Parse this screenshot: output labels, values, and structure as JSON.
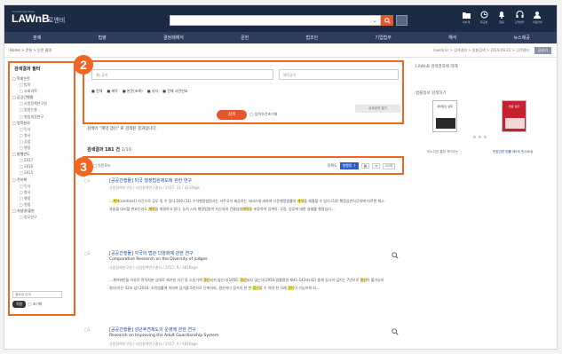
{
  "app": {
    "logo": "LAWnB",
    "logo_tiny": "Knowledge Base",
    "logo_sub": "로앤비"
  },
  "toolbar": {
    "icons": [
      {
        "name": "folder-icon",
        "label": "내서재"
      },
      {
        "name": "history-icon",
        "label": "최근본"
      },
      {
        "name": "bell-icon",
        "label": "알림"
      },
      {
        "name": "headset-icon",
        "label": "고객센터"
      },
      {
        "name": "user-icon",
        "label": "사용안내"
      }
    ]
  },
  "nav": {
    "items": [
      "판례",
      "법령",
      "결정례해석",
      "문헌",
      "법조인",
      "기업법무",
      "해석",
      "뉴스제공"
    ]
  },
  "breadcrumb": {
    "left": "Home > 문헌 > 논문 결과",
    "right_path": "lawnb.kr > 검색결과 > 맞춤검색 > 2019.09.22 > 고객센터",
    "button": "공유기"
  },
  "sidebar": {
    "title": "검색결과 필터",
    "items": [
      {
        "label": "□ 학회논문",
        "sub": false
      },
      {
        "label": "□ 법학",
        "sub": true
      },
      {
        "label": "□ 사회과학",
        "sub": true
      },
      {
        "label": "□ 공공간행물",
        "sub": false
      },
      {
        "label": "□ 사법정책연구원",
        "sub": true
      },
      {
        "label": "□ 법원논총",
        "sub": true
      },
      {
        "label": "□ 형법개정연구",
        "sub": true
      },
      {
        "label": "□ 법학분야",
        "sub": false
      },
      {
        "label": "□ 민사",
        "sub": true
      },
      {
        "label": "□ 형사",
        "sub": true
      },
      {
        "label": "□ 공법",
        "sub": true
      },
      {
        "label": "□ 행정",
        "sub": true
      },
      {
        "label": "□ 발행연도",
        "sub": false
      },
      {
        "label": "□ 2017",
        "sub": true
      },
      {
        "label": "□ 2016",
        "sub": true
      },
      {
        "label": "□ 2015",
        "sub": true
      },
      {
        "label": "□ 전자책",
        "sub": false
      },
      {
        "label": "□ 민사",
        "sub": true
      },
      {
        "label": "□ 형사",
        "sub": true
      },
      {
        "label": "□ 행정",
        "sub": true
      },
      {
        "label": "□ 헌법",
        "sub": true
      },
      {
        "label": "□ 저널명/출판",
        "sub": false
      },
      {
        "label": "□ 법무연구",
        "sub": true
      }
    ],
    "search_placeholder": "결과내 검색",
    "apply": "적용",
    "reset": "◯ 초기화"
  },
  "search": {
    "field1": "예) 검색",
    "field2": "제목검색",
    "checks": [
      "■ 전체",
      "■ 제목",
      "■ 본문(초록)",
      "■ 저자",
      "■ 전체 사전번호"
    ],
    "go": "검색",
    "reset_all": "◯ 입력조건초기화",
    "advanced": "상세검색 열기"
  },
  "summary": "검색어 \"계약 갱신\" 로 검색된 결과입니다.",
  "count": {
    "label": "검색결과 181 건",
    "pages": "1/10"
  },
  "result_bar": {
    "left": "□ 다운로드",
    "sort_label": "정확도",
    "sort_pill": "발행일 ↑",
    "per_page": "20개"
  },
  "results": [
    {
      "num": "□1",
      "title": "[공공간행물] 미국 행정법원제도에 관한 연구",
      "meta": "사법정책연구원 / 사법정책연구총서 / 2017. 11 / 311Page",
      "body": [
        {
          "t": "..."
        },
        {
          "t": "계약",
          "m": true
        },
        {
          "t": "(contract) 사건으로 공무 및 수 있다.100.(11) 수석행정법원사는 서주국이 제공하는 서비스에 대하여 다운"
        },
        {
          "t": "행정법률의 "
        },
        {
          "t": "계약",
          "m": true
        },
        {
          "t": "을 채결할 수 있다.(14) 행정심판사무처에 따르면 재소자들을 대리할 변호인과도 "
        },
        {
          "t": "계약",
          "m": true
        },
        {
          "t": "을 체결하"
        },
        {
          "t": "고 있다. 능차 시의 행정법원의 자산과의 건물임대"
        },
        {
          "t": "계약",
          "m": true
        },
        {
          "t": "을 포함하여 업계의, 규정, 업무에 대한 실제를 행정심리..."
        }
      ]
    },
    {
      "num": "□2",
      "title": "[공공간행물] 각국의 법관 다양화에 관한 연구",
      "sub": "Comparative Research on the Diversity of Judges",
      "meta": "사법정책연구원 / 사법정책연구총서 / 2017. 9 / 381Page",
      "body": [
        {
          "t": "...계약",
          "m": false
        },
        {
          "t": "위반을 이유로 면직처분 상대로 제기한 사건 중 소송가액 "
        },
        {
          "t": "갱신",
          "m": true
        },
        {
          "t": "되지 않는다(1956. "
        },
        {
          "t": "갱신",
          "m": true
        },
        {
          "t": "되지 않는다(1956."
        },
        {
          "t": "법률명칭 제41-143조)42) 중재 임시의 임기는 7년으로 "
        },
        {
          "t": "갱신",
          "m": true
        },
        {
          "t": "이 불가능하였다(이은 42조 상) 2016. 조직"
        },
        {
          "t": "법률에 의하여 임기를 5년으로 단축하되, 갱신하다 장기의 한 번 "
        },
        {
          "t": "갱신",
          "m": true
        },
        {
          "t": "할 수 하여 한 차례 "
        },
        {
          "t": "갱신",
          "m": true
        },
        {
          "t": "이 가능하게 되..."
        }
      ]
    },
    {
      "num": "□3",
      "title": "[공공간행물] 성년후견제도의 운영에 관한 연구",
      "sub": "Research on Improving the Adult Guardianship System",
      "meta": "사법정책연구원 / 사법정책연구총서 / 2017. 9 / 481Page"
    }
  ],
  "right_panel": {
    "heading1": "LAWnB 검색결과에 대해",
    "heading2": "법률정보 검색하기",
    "books": [
      {
        "cover": "계약갱신 실무",
        "title": "이노디언 홍정 적어주는"
      },
      {
        "cover": "법원 실무",
        "title": "민법관련 법률 제5조 민사소송"
      }
    ]
  }
}
